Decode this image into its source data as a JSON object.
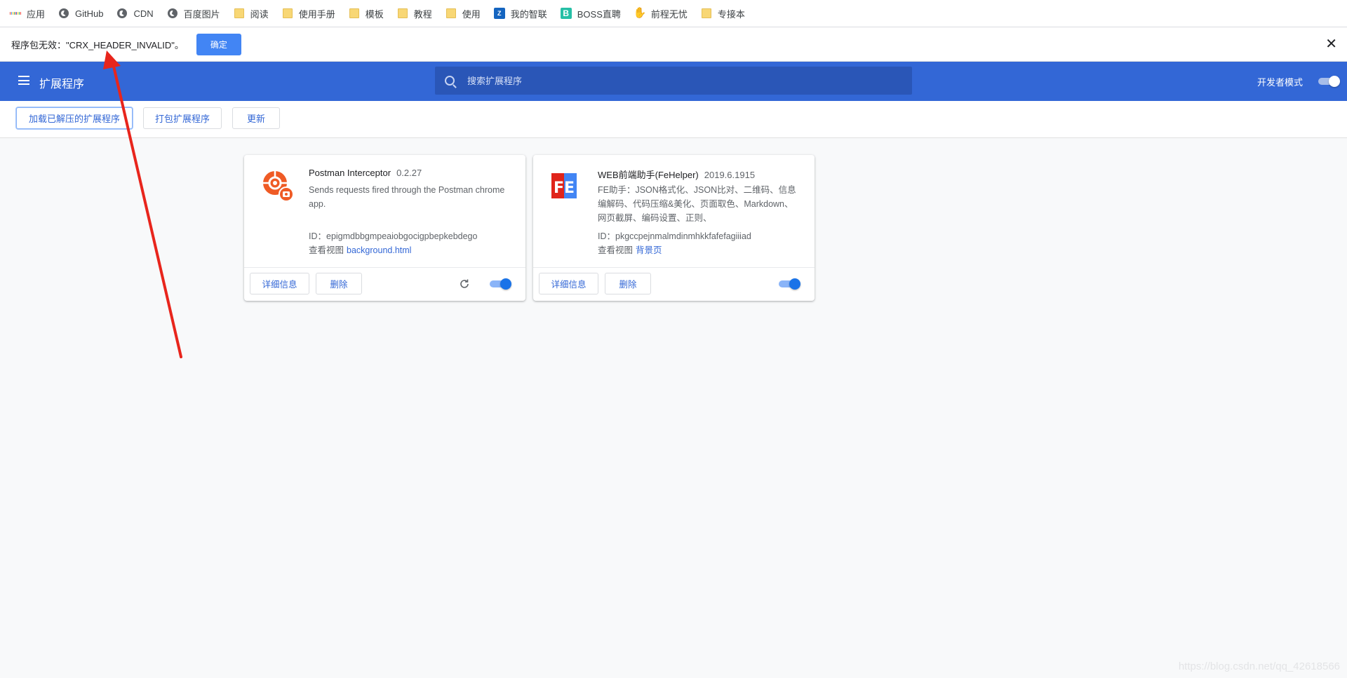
{
  "bookmarks": [
    {
      "label": "应用",
      "icon": "apps-icon"
    },
    {
      "label": "GitHub",
      "icon": "globe-icon"
    },
    {
      "label": "CDN",
      "icon": "globe-icon"
    },
    {
      "label": "百度图片",
      "icon": "globe-icon"
    },
    {
      "label": "阅读",
      "icon": "folder-icon"
    },
    {
      "label": "使用手册",
      "icon": "folder-icon"
    },
    {
      "label": "模板",
      "icon": "folder-icon"
    },
    {
      "label": "教程",
      "icon": "folder-icon"
    },
    {
      "label": "使用",
      "icon": "folder-icon"
    },
    {
      "label": "我的智联",
      "icon": "zhilian-icon"
    },
    {
      "label": "BOSS直聘",
      "icon": "boss-icon"
    },
    {
      "label": "前程无忧",
      "icon": "hand-icon"
    },
    {
      "label": "专接本",
      "icon": "folder-icon"
    }
  ],
  "error_bar": {
    "message": "程序包无效：\"CRX_HEADER_INVALID\"。",
    "ok_label": "确定",
    "close_glyph": "✕"
  },
  "header": {
    "title": "扩展程序",
    "search_placeholder": "搜索扩展程序",
    "dev_mode_label": "开发者模式",
    "dev_mode_on": true
  },
  "toolbar": {
    "load_unpacked": "加载已解压的扩展程序",
    "pack": "打包扩展程序",
    "update": "更新"
  },
  "extensions": [
    {
      "name": "Postman Interceptor",
      "version": "0.2.27",
      "description": "Sends requests fired through the Postman chrome app.",
      "id_text": "ID：epigmdbbgmpeaiobgocigpbepkebdego",
      "views_label": "查看视图",
      "view_link": "background.html",
      "details_label": "详细信息",
      "remove_label": "删除",
      "enabled": true,
      "has_reload": true
    },
    {
      "name": "WEB前端助手(FeHelper)",
      "version": "2019.6.1915",
      "description": "FE助手：JSON格式化、JSON比对、二维码、信息编解码、代码压缩&美化、页面取色、Markdown、网页截屏、编码设置、正则、",
      "id_text": "ID：pkgccpejnmalmdinmhkkfafefagiiiad",
      "views_label": "查看视图",
      "view_link": "背景页",
      "details_label": "详细信息",
      "remove_label": "删除",
      "enabled": true,
      "has_reload": false
    }
  ],
  "watermark": "https://blog.csdn.net/qq_42618566",
  "colors": {
    "header_bg": "#3367d6",
    "accent": "#1a73e8",
    "arrow": "#e8251c"
  }
}
